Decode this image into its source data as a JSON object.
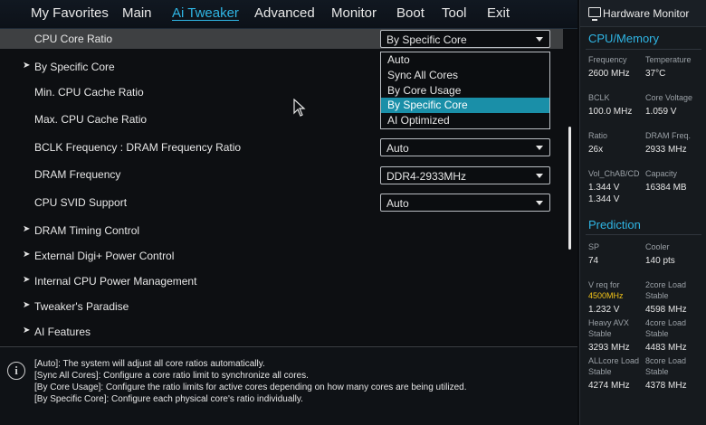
{
  "menu": {
    "tabs": [
      "My Favorites",
      "Main",
      "Ai Tweaker",
      "Advanced",
      "Monitor",
      "Boot",
      "Tool",
      "Exit"
    ],
    "active": "Ai Tweaker"
  },
  "settings": {
    "cpu_core_ratio": {
      "label": "CPU Core Ratio",
      "value": "By Specific Core"
    },
    "by_specific_core": {
      "label": "By Specific Core"
    },
    "min_cache": {
      "label": "Min. CPU Cache Ratio"
    },
    "max_cache": {
      "label": "Max. CPU Cache Ratio"
    },
    "bclk_dram": {
      "label": "BCLK Frequency : DRAM Frequency Ratio",
      "value": "Auto"
    },
    "dram_freq": {
      "label": "DRAM Frequency",
      "value": "DDR4-2933MHz"
    },
    "svid": {
      "label": "CPU SVID Support",
      "value": "Auto"
    },
    "dram_timing": {
      "label": "DRAM Timing Control"
    },
    "digi": {
      "label": "External Digi+ Power Control"
    },
    "cpu_power": {
      "label": "Internal CPU Power Management"
    },
    "paradise": {
      "label": "Tweaker's Paradise"
    },
    "ai_features": {
      "label": "AI Features"
    }
  },
  "dropdown": {
    "options": [
      "Auto",
      "Sync All Cores",
      "By Core Usage",
      "By Specific Core",
      "AI Optimized"
    ],
    "selected_index": 3
  },
  "help": {
    "lines": [
      "[Auto]: The system will adjust all core ratios automatically.",
      "[Sync All Cores]: Configure a core ratio limit to synchronize all cores.",
      "[By Core Usage]: Configure the ratio limits for active cores depending on how many cores are being utilized.",
      "[By Specific Core]: Configure each physical core's ratio individually."
    ]
  },
  "hardware_monitor": {
    "title": "Hardware Monitor",
    "cpu_memory": {
      "heading": "CPU/Memory",
      "frequency_label": "Frequency",
      "frequency": "2600 MHz",
      "temperature_label": "Temperature",
      "temperature": "37°C",
      "bclk_label": "BCLK",
      "bclk": "100.0 MHz",
      "core_voltage_label": "Core Voltage",
      "core_voltage": "1.059 V",
      "ratio_label": "Ratio",
      "ratio": "26x",
      "dram_freq_label": "DRAM Freq.",
      "dram_freq": "2933 MHz",
      "vol_label": "Vol_ChAB/CD",
      "vol_1": "1.344 V",
      "vol_2": "1.344 V",
      "capacity_label": "Capacity",
      "capacity": "16384 MB"
    },
    "prediction": {
      "heading": "Prediction",
      "sp_label": "SP",
      "sp": "74",
      "cooler_label": "Cooler",
      "cooler": "140 pts",
      "vreq_label": "V req for",
      "vreq_freq": "4500MHz",
      "vreq": "1.232 V",
      "two_core_label_1": "2core Load",
      "two_core_label_2": "Stable",
      "two_core": "4598 MHz",
      "heavy_avx_label_1": "Heavy AVX",
      "heavy_avx_label_2": "Stable",
      "heavy_avx": "3293 MHz",
      "four_core_label_1": "4core Load",
      "four_core_label_2": "Stable",
      "four_core": "4483 MHz",
      "allcore_label_1": "ALLcore Load",
      "allcore_label_2": "Stable",
      "allcore": "4274 MHz",
      "eight_core_label_1": "8core Load",
      "eight_core_label_2": "Stable",
      "eight_core": "4378 MHz"
    }
  },
  "colors": {
    "accent": "#2fb6e5",
    "selected": "#1a8fa8",
    "highlight": "#f2c318"
  }
}
